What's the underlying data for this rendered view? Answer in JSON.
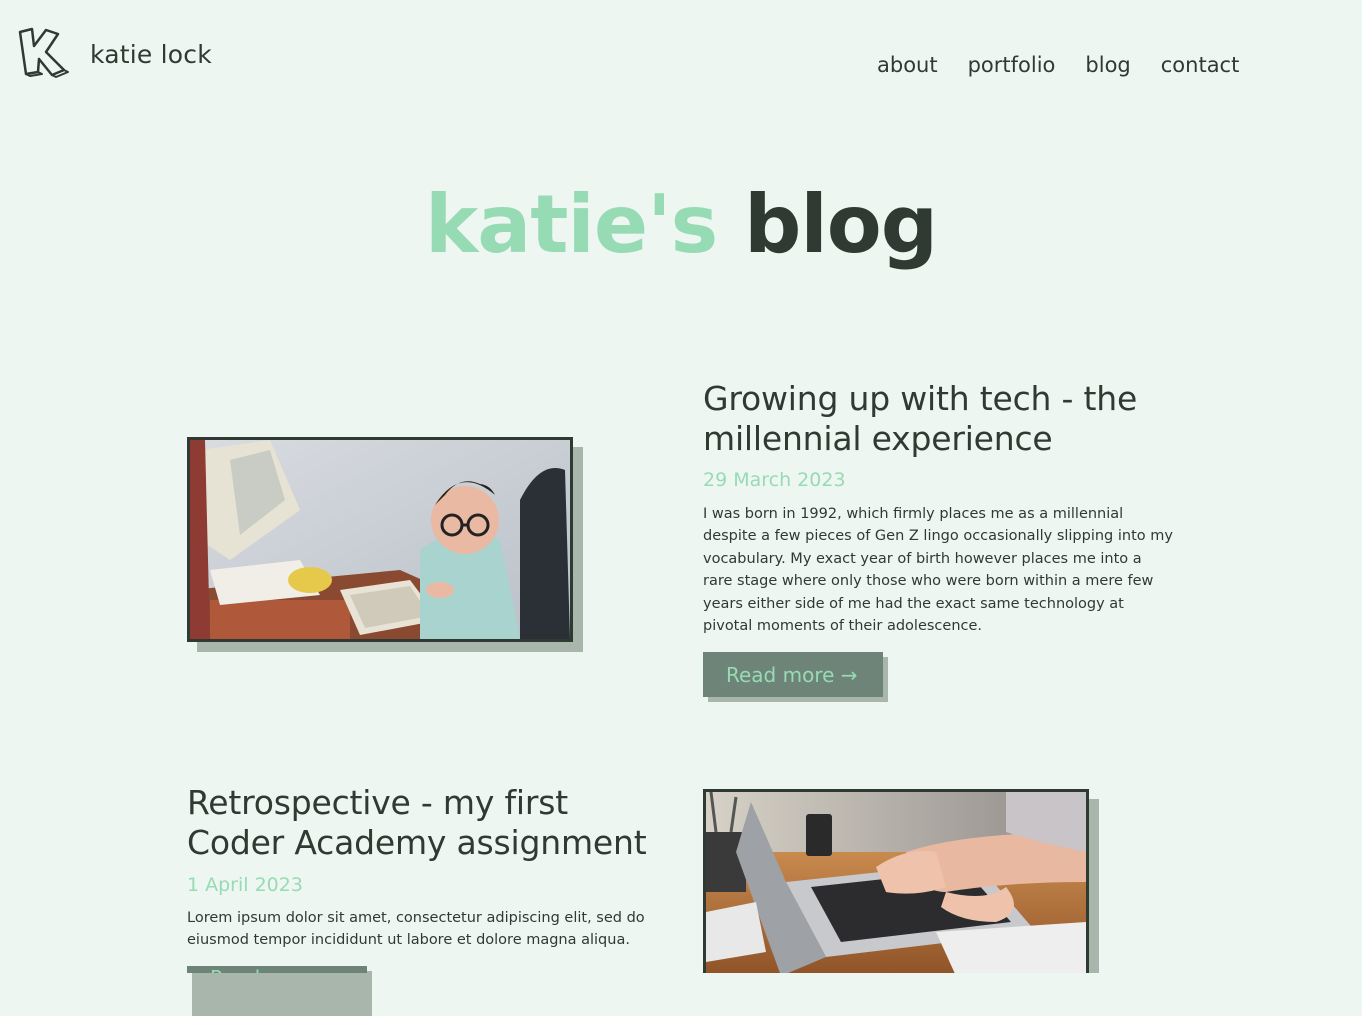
{
  "header": {
    "site_name": "katie lock",
    "logo_icon": "k-letter-logo-icon",
    "nav": [
      {
        "label": "about"
      },
      {
        "label": "portfolio"
      },
      {
        "label": "blog"
      },
      {
        "label": "contact"
      }
    ]
  },
  "hero": {
    "accent_text": "katie's",
    "dark_text": "blog"
  },
  "posts": [
    {
      "title": "Growing up with tech - the millennial experience",
      "date": "29 March 2023",
      "excerpt": "I was born in 1992, which firmly places me as a millennial despite a few pieces of Gen Z lingo occasionally slipping into my vocabulary. My exact year of birth however places me into a rare stage where only those who were born within a mere few years either side of me had the exact same technology at pivotal moments of their adolescence.",
      "button_label": "Read more →",
      "image_icon": "child-at-computer-photo"
    },
    {
      "title": "Retrospective - my first Coder Academy assignment",
      "date": "1 April 2023",
      "excerpt": "Lorem ipsum dolor sit amet, consectetur adipiscing elit, sed do eiusmod tempor incididunt ut labore et dolore magna aliqua.",
      "button_label": "Read more →",
      "image_icon": "hands-typing-laptop-photo"
    }
  ],
  "colors": {
    "background": "#eef6f1",
    "text": "#2f3a33",
    "accent": "#97dbb5",
    "button": "#6f8478",
    "shadow": "#a8b6ac"
  }
}
